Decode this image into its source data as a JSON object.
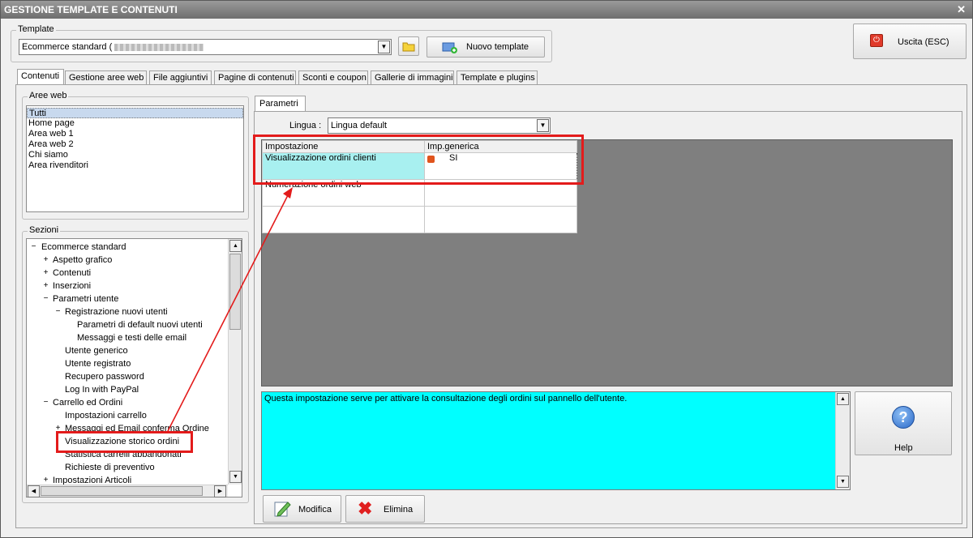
{
  "window": {
    "title": "GESTIONE TEMPLATE E CONTENUTI",
    "close": "✕"
  },
  "template": {
    "group_label": "Template",
    "selected": "Ecommerce standard (",
    "new_button": "Nuovo template"
  },
  "exit_button": "Uscita (ESC)",
  "tabs": [
    "Contenuti",
    "Gestione aree web",
    "File aggiuntivi",
    "Pagine di contenuti",
    "Sconti e coupon",
    "Gallerie di immagini",
    "Template e plugins"
  ],
  "aree_web": {
    "label": "Aree web",
    "items": [
      "Tutti",
      "Home page",
      "Area web 1",
      "Area web 2",
      "Chi siamo",
      "Area rivenditori"
    ]
  },
  "sezioni": {
    "label": "Sezioni",
    "tree": [
      {
        "text": "Ecommerce standard",
        "level": 0,
        "exp": "−"
      },
      {
        "text": "Aspetto grafico",
        "level": 1,
        "exp": "+"
      },
      {
        "text": "Contenuti",
        "level": 1,
        "exp": "+"
      },
      {
        "text": "Inserzioni",
        "level": 1,
        "exp": "+"
      },
      {
        "text": "Parametri utente",
        "level": 1,
        "exp": "−"
      },
      {
        "text": "Registrazione nuovi utenti",
        "level": 2,
        "exp": "−"
      },
      {
        "text": "Parametri di default nuovi utenti",
        "level": 3,
        "exp": ""
      },
      {
        "text": "Messaggi e testi delle email",
        "level": 3,
        "exp": ""
      },
      {
        "text": "Utente generico",
        "level": 2,
        "exp": ""
      },
      {
        "text": "Utente registrato",
        "level": 2,
        "exp": ""
      },
      {
        "text": "Recupero password",
        "level": 2,
        "exp": ""
      },
      {
        "text": "Log In with PayPal",
        "level": 2,
        "exp": ""
      },
      {
        "text": "Carrello ed Ordini",
        "level": 1,
        "exp": "−"
      },
      {
        "text": "Impostazioni carrello",
        "level": 2,
        "exp": ""
      },
      {
        "text": "Messaggi ed Email conferma Ordine",
        "level": 2,
        "exp": "+"
      },
      {
        "text": "Visualizzazione storico ordini",
        "level": 2,
        "exp": ""
      },
      {
        "text": "Statistica carrelli abbandonati",
        "level": 2,
        "exp": ""
      },
      {
        "text": "Richieste di preventivo",
        "level": 2,
        "exp": ""
      },
      {
        "text": "Impostazioni Articoli",
        "level": 1,
        "exp": "+"
      }
    ]
  },
  "parametri": {
    "tab": "Parametri",
    "lingua_label": "Lingua :",
    "lingua_value": "Lingua default",
    "grid_headers": [
      "Impostazione",
      "Imp.generica"
    ],
    "rows": [
      {
        "name": "Visualizzazione ordini clienti",
        "value": "SI"
      },
      {
        "name": "Numerazione ordini web",
        "value": ""
      },
      {
        "name": "",
        "value": ""
      }
    ],
    "description": "Questa impostazione serve per attivare la consultazione degli ordini sul pannello dell'utente."
  },
  "help_button": "Help",
  "modifica_button": "Modifica",
  "elimina_button": "Elimina",
  "colors": {
    "highlight": "#e31b1b",
    "cyan": "#00ffff",
    "row_selected": "#a8f0f0"
  }
}
